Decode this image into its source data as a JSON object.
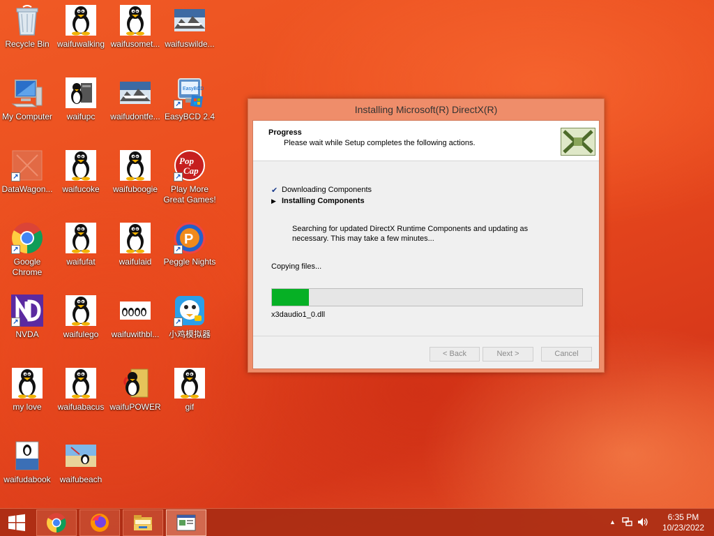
{
  "desktop": {
    "icons": [
      {
        "label": "Recycle Bin",
        "icon": "recycle-bin-icon"
      },
      {
        "label": "waifuwalking",
        "icon": "tux-icon"
      },
      {
        "label": "waifusomet...",
        "icon": "tux-icon"
      },
      {
        "label": "waifuswilde...",
        "icon": "image-icon"
      },
      {
        "label": "My Computer",
        "icon": "computer-icon"
      },
      {
        "label": "waifupc",
        "icon": "tux-pc-icon"
      },
      {
        "label": "waifudontfe...",
        "icon": "image-icon"
      },
      {
        "label": "EasyBCD 2.4",
        "icon": "easybcd-icon"
      },
      {
        "label": "DataWagon...",
        "icon": "datawagon-icon"
      },
      {
        "label": "waifucoke",
        "icon": "tux-icon"
      },
      {
        "label": "waifuboogie",
        "icon": "tux-icon"
      },
      {
        "label": "Play More Great Games!",
        "icon": "popcap-icon"
      },
      {
        "label": "Google Chrome",
        "icon": "chrome-icon"
      },
      {
        "label": "waifufat",
        "icon": "tux-icon"
      },
      {
        "label": "waifulaid",
        "icon": "tux-icon"
      },
      {
        "label": "Peggle Nights",
        "icon": "peggle-icon"
      },
      {
        "label": "NVDA",
        "icon": "nvda-icon"
      },
      {
        "label": "waifulego",
        "icon": "tux-icon"
      },
      {
        "label": "waifuwithbl...",
        "icon": "tux-group-icon"
      },
      {
        "label": "小鸡模拟器",
        "icon": "emulator-icon"
      },
      {
        "label": "my love",
        "icon": "tux-icon"
      },
      {
        "label": "waifuabacus",
        "icon": "tux-icon"
      },
      {
        "label": "waifuPOWER",
        "icon": "linux-powered-icon"
      },
      {
        "label": "gif",
        "icon": "tux-icon"
      },
      {
        "label": "waifudabook",
        "icon": "book-icon"
      },
      {
        "label": "waifubeach",
        "icon": "tux-beach-icon"
      }
    ]
  },
  "dialog": {
    "title": "Installing Microsoft(R) DirectX(R)",
    "header_title": "Progress",
    "header_subtitle": "Please wait while Setup completes the following actions.",
    "steps": [
      {
        "mark": "✔",
        "label": "Downloading Components",
        "state": "done"
      },
      {
        "mark": "▶",
        "label": "Installing Components",
        "state": "active"
      }
    ],
    "description": "Searching for updated DirectX Runtime Components and updating as necessary. This may take a few minutes...",
    "status": "Copying files...",
    "progress_percent": 12,
    "current_file": "x3daudio1_0.dll",
    "buttons": {
      "back": "< Back",
      "next": "Next >",
      "cancel": "Cancel"
    }
  },
  "taskbar": {
    "apps": [
      "chrome-icon",
      "firefox-icon",
      "file-explorer-icon",
      "directx-setup-icon"
    ],
    "time": "6:35 PM",
    "date": "10/23/2022"
  },
  "colors": {
    "progress": "#06b025",
    "taskbar": "#aa2d14",
    "dialog_frame": "#ef8d6a"
  }
}
